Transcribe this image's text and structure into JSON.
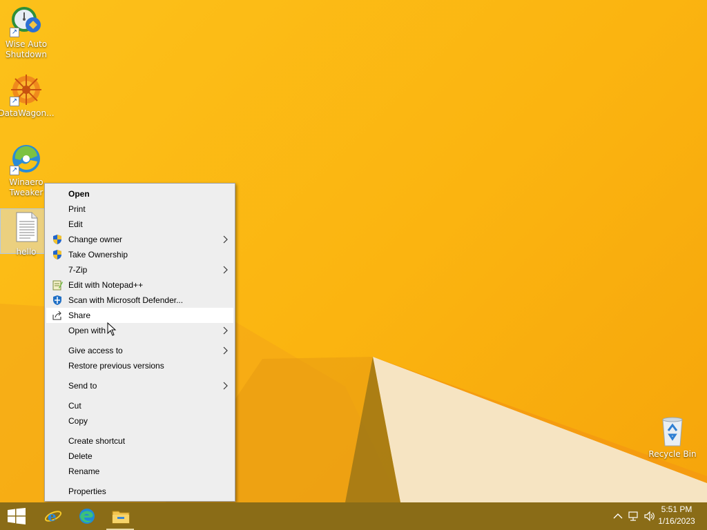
{
  "desktop": {
    "icons": [
      {
        "label": "Wise Auto\nShutdown",
        "icon": "wise-auto-shutdown-icon"
      },
      {
        "label": "DataWagon...",
        "icon": "datawagon-icon"
      },
      {
        "label": "Winaero\nTweaker",
        "icon": "winaero-tweaker-icon"
      },
      {
        "label": "hello",
        "icon": "text-file-icon"
      },
      {
        "label": "Recycle Bin",
        "icon": "recycle-bin-icon"
      }
    ]
  },
  "context_menu": {
    "items": [
      {
        "label": "Open",
        "bold": true
      },
      {
        "label": "Print"
      },
      {
        "label": "Edit"
      },
      {
        "label": "Change owner",
        "icon": "uac-shield-icon",
        "submenu": true
      },
      {
        "label": "Take Ownership",
        "icon": "uac-shield-icon"
      },
      {
        "label": "7-Zip",
        "submenu": true
      },
      {
        "label": "Edit with Notepad++",
        "icon": "notepad-plus-plus-icon"
      },
      {
        "label": "Scan with Microsoft Defender...",
        "icon": "defender-icon"
      },
      {
        "label": "Share",
        "icon": "share-icon",
        "hovered": true
      },
      {
        "label": "Open with",
        "submenu": true
      },
      {
        "label": "Give access to",
        "submenu": true
      },
      {
        "label": "Restore previous versions"
      },
      {
        "label": "Send to",
        "submenu": true
      },
      {
        "label": "Cut"
      },
      {
        "label": "Copy"
      },
      {
        "label": "Create shortcut"
      },
      {
        "label": "Delete"
      },
      {
        "label": "Rename"
      },
      {
        "label": "Properties"
      }
    ]
  },
  "taskbar": {
    "pinned": [
      "start-button",
      "internet-explorer-icon",
      "edge-icon",
      "file-explorer-icon"
    ],
    "tray": [
      "chevron-up-icon",
      "network-icon",
      "volume-icon"
    ],
    "clock": {
      "time": "5:51 PM",
      "date": "1/16/2023"
    }
  },
  "colors": {
    "taskbar": "#8a6c17",
    "desktop": "#fbb410",
    "menu": "#eeeeee"
  }
}
